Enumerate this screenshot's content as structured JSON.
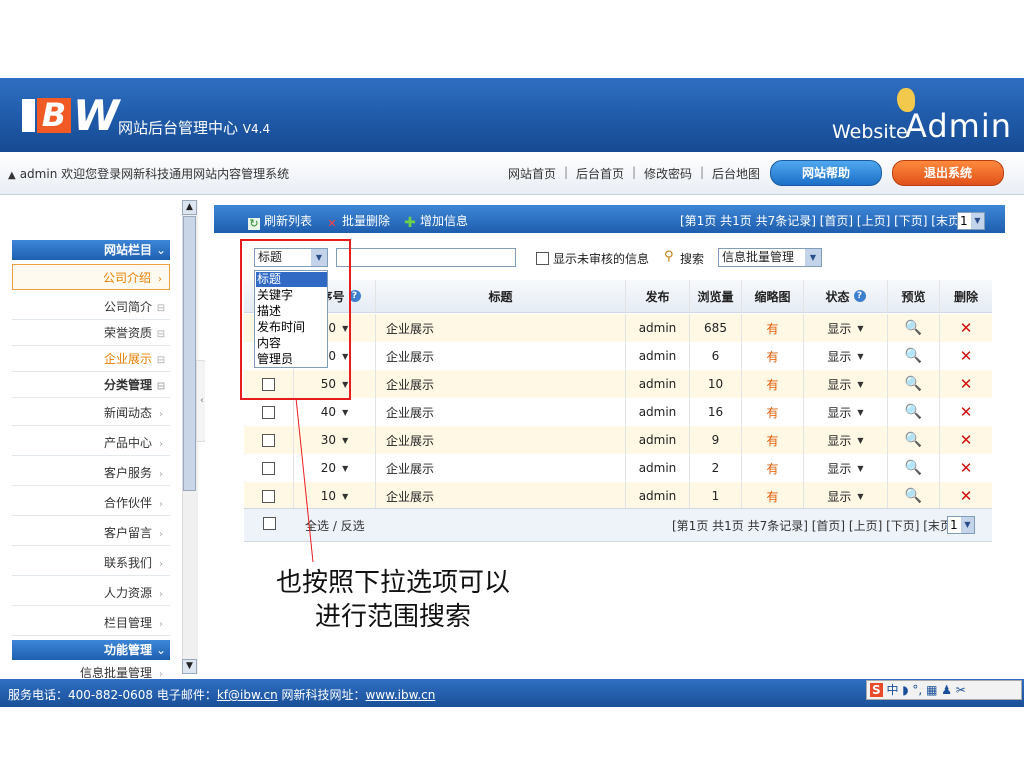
{
  "header": {
    "logo_i": "I",
    "logo_b": "B",
    "logo_w": "W",
    "title": "网站后台管理中心",
    "version": "V4.4",
    "brand_left": "Website",
    "brand_right": "Admin"
  },
  "topbar": {
    "welcome": "admin 欢迎您登录网新科技通用网站内容管理系统",
    "links": [
      "网站首页",
      "后台首页",
      "修改密码",
      "后台地图"
    ],
    "separator": "|",
    "help_button": "网站帮助",
    "logout_button": "退出系统"
  },
  "sidebar": {
    "section1": "网站栏目",
    "items": [
      {
        "label": "公司介绍",
        "marker": "›",
        "state": "active-box"
      },
      {
        "label": "公司简介",
        "marker": "⊟",
        "state": ""
      },
      {
        "label": "荣誉资质",
        "marker": "⊟",
        "state": ""
      },
      {
        "label": "企业展示",
        "marker": "⊟",
        "state": "active"
      },
      {
        "label": "分类管理",
        "marker": "⊟",
        "state": "bold"
      },
      {
        "label": "新闻动态",
        "marker": "›",
        "state": ""
      },
      {
        "label": "产品中心",
        "marker": "›",
        "state": ""
      },
      {
        "label": "客户服务",
        "marker": "›",
        "state": ""
      },
      {
        "label": "合作伙伴",
        "marker": "›",
        "state": ""
      },
      {
        "label": "客户留言",
        "marker": "›",
        "state": ""
      },
      {
        "label": "联系我们",
        "marker": "›",
        "state": ""
      },
      {
        "label": "人力资源",
        "marker": "›",
        "state": ""
      },
      {
        "label": "栏目管理",
        "marker": "›",
        "state": ""
      }
    ],
    "section2": "功能管理",
    "partial_item": "信息批量管理"
  },
  "toolbar": {
    "refresh": "刷新列表",
    "batch_delete": "批量删除",
    "add": "增加信息",
    "pager": "[第1页 共1页 共7条记录] [首页] [上页] [下页] [末页]",
    "page_value": "1"
  },
  "search": {
    "field_value": "标题",
    "unreviewed_label": "显示未审核的信息",
    "search_label": "搜索",
    "batch_value": "信息批量管理"
  },
  "dropdown": {
    "options": [
      "标题",
      "关键字",
      "描述",
      "发布时间",
      "内容",
      "管理员"
    ],
    "selected_index": 0
  },
  "table": {
    "headers": {
      "order": "排序号",
      "title": "标题",
      "publisher": "发布",
      "views": "浏览量",
      "thumb": "缩略图",
      "status": "状态",
      "preview": "预览",
      "delete": "删除"
    },
    "rows": [
      {
        "order": "70",
        "title": "企业展示",
        "publisher": "admin",
        "views": "685",
        "thumb": "有",
        "status": "显示"
      },
      {
        "order": "60",
        "title": "企业展示",
        "publisher": "admin",
        "views": "6",
        "thumb": "有",
        "status": "显示"
      },
      {
        "order": "50",
        "title": "企业展示",
        "publisher": "admin",
        "views": "10",
        "thumb": "有",
        "status": "显示"
      },
      {
        "order": "40",
        "title": "企业展示",
        "publisher": "admin",
        "views": "16",
        "thumb": "有",
        "status": "显示"
      },
      {
        "order": "30",
        "title": "企业展示",
        "publisher": "admin",
        "views": "9",
        "thumb": "有",
        "status": "显示"
      },
      {
        "order": "20",
        "title": "企业展示",
        "publisher": "admin",
        "views": "2",
        "thumb": "有",
        "status": "显示"
      },
      {
        "order": "10",
        "title": "企业展示",
        "publisher": "admin",
        "views": "1",
        "thumb": "有",
        "status": "显示"
      }
    ],
    "footer_select": "全选 / 反选",
    "footer_pager": "[第1页 共1页 共7条记录] [首页] [上页] [下页] [末页]",
    "footer_page_value": "1"
  },
  "annotation": {
    "line1": "也按照下拉选项可以",
    "line2": "进行范围搜索"
  },
  "footer": {
    "phone": "服务电话：400-882-0608 电子邮件：",
    "email": "kf@ibw.cn",
    "site_label": " 网新科技网址：",
    "site": "www.ibw.cn"
  },
  "ime": {
    "text": "中 ◗ °, ▦ ♟ ✂"
  },
  "colors": {
    "brand_blue": "#1f5aa8",
    "accent_orange": "#f15a24",
    "highlight_red": "#e81c1c",
    "row_alt": "#fff8e5"
  }
}
